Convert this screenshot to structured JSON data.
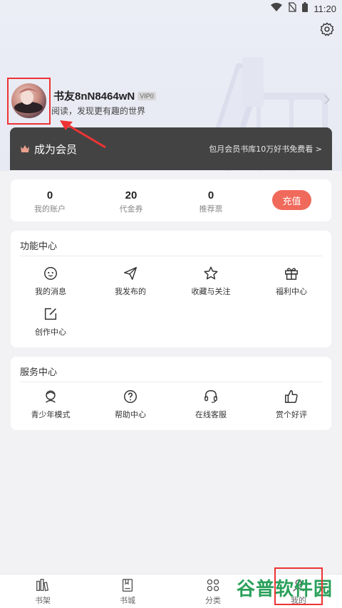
{
  "status_bar": {
    "time": "11:20"
  },
  "profile": {
    "username": "书友8nN8464wN",
    "vip_badge": "VIP0",
    "tagline": "阅读，发现更有趣的世界"
  },
  "vip_banner": {
    "title": "成为会员",
    "promo": "包月会员书库10万好书免费看 >"
  },
  "stats": [
    {
      "value": "0",
      "label": "我的账户"
    },
    {
      "value": "20",
      "label": "代金券"
    },
    {
      "value": "0",
      "label": "推荐票"
    }
  ],
  "recharge_label": "充值",
  "function_center": {
    "title": "功能中心",
    "items": [
      {
        "label": "我的消息",
        "icon": "message-icon"
      },
      {
        "label": "我发布的",
        "icon": "send-icon"
      },
      {
        "label": "收藏与关注",
        "icon": "star-icon"
      },
      {
        "label": "福利中心",
        "icon": "gift-icon"
      },
      {
        "label": "创作中心",
        "icon": "edit-icon"
      }
    ]
  },
  "service_center": {
    "title": "服务中心",
    "items": [
      {
        "label": "青少年模式",
        "icon": "teen-mode-icon"
      },
      {
        "label": "帮助中心",
        "icon": "help-icon"
      },
      {
        "label": "在线客服",
        "icon": "headset-icon"
      },
      {
        "label": "赏个好评",
        "icon": "thumbs-up-icon"
      }
    ]
  },
  "tabs": [
    {
      "label": "书架",
      "icon": "bookshelf-icon"
    },
    {
      "label": "书城",
      "icon": "bookstore-icon"
    },
    {
      "label": "分类",
      "icon": "category-icon"
    },
    {
      "label": "我的",
      "icon": "profile-icon"
    }
  ],
  "watermark": "谷普软件园",
  "colors": {
    "accent": "#f06a5c",
    "vip_card": "#434343",
    "highlight": "#ee3333",
    "watermark": "#2aa05a"
  }
}
